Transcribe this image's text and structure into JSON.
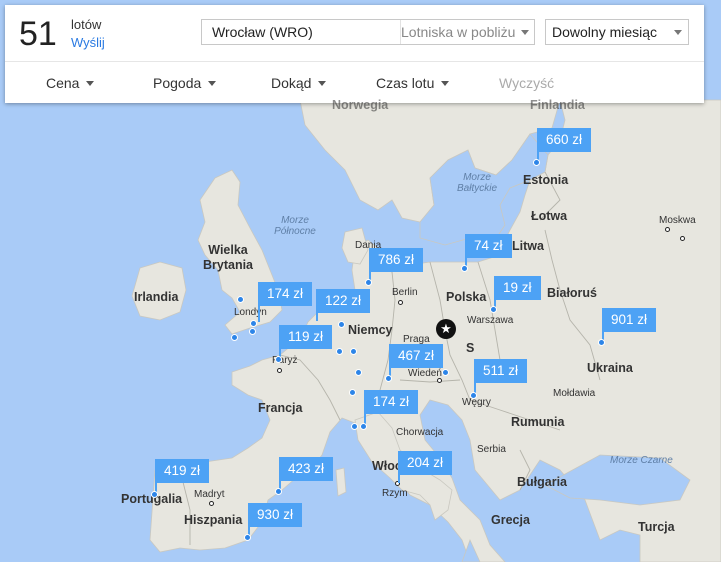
{
  "header": {
    "count": "51",
    "count_unit": "lotów",
    "send_label": "Wyślij",
    "origin_value": "Wrocław (WRO)",
    "nearby_label": "Lotniska w pobliżu",
    "month_value": "Dowolny miesiąc"
  },
  "filters": {
    "price": "Cena",
    "weather": "Pogoda",
    "where": "Dokąd",
    "duration": "Czas lotu",
    "clear": "Wyczyść"
  },
  "colors": {
    "water": "#a9cbf7",
    "land": "#e7e6df",
    "price_tag": "#4da2f5",
    "link": "#2a7ae2"
  },
  "map": {
    "countries": [
      "Norwegia",
      "Finlandia",
      "Estonia",
      "Łotwa",
      "Litwa",
      "Białoruś",
      "Polska",
      "Niemcy",
      "Irlandia",
      "Wielka Brytania",
      "Francja",
      "Ukraina",
      "Mołdawia",
      "Rumunia",
      "Serbia",
      "Bułgaria",
      "Chorwacja",
      "Włochy",
      "Hiszpania",
      "Portugalia",
      "Grecja",
      "Turcja",
      "Węgry",
      "Dania",
      "S"
    ],
    "cities": [
      "Moskwa",
      "Warszawa",
      "Berlin",
      "Praga",
      "Wiedeń",
      "Londyn",
      "Paryż",
      "Madryt",
      "Rzym"
    ],
    "seas": {
      "baltic": "Morze Bałtyckie",
      "north": "Morze Północne",
      "black": "Morze Czarne"
    }
  },
  "prices": [
    {
      "label": "660 zł"
    },
    {
      "label": "74 zł"
    },
    {
      "label": "786 zł"
    },
    {
      "label": "19 zł"
    },
    {
      "label": "174 zł"
    },
    {
      "label": "122 zł"
    },
    {
      "label": "119 zł"
    },
    {
      "label": "901 zł"
    },
    {
      "label": "467 zł"
    },
    {
      "label": "511 zł"
    },
    {
      "label": "174 zł"
    },
    {
      "label": "419 zł"
    },
    {
      "label": "423 zł"
    },
    {
      "label": "204 zł"
    },
    {
      "label": "930 zł"
    }
  ]
}
